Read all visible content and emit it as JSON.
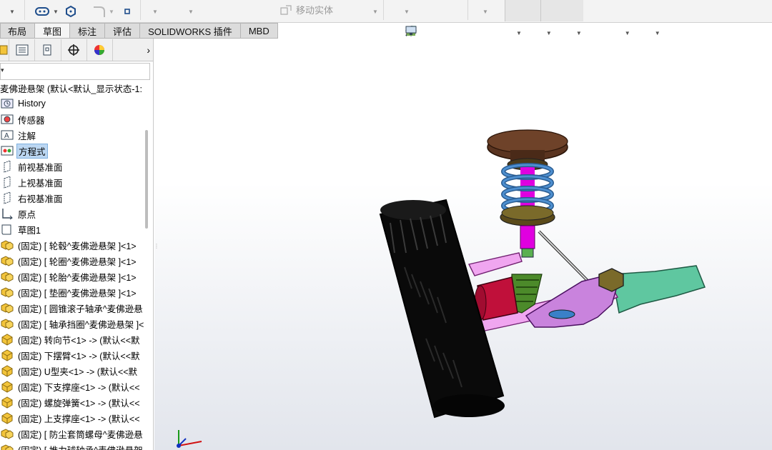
{
  "ribbon": {
    "move_body_label": "移动实体"
  },
  "tabs": [
    {
      "label": "布局",
      "active": false
    },
    {
      "label": "草图",
      "active": true
    },
    {
      "label": "标注",
      "active": false
    },
    {
      "label": "评估",
      "active": false
    },
    {
      "label": "SOLIDWORKS 插件",
      "active": false
    },
    {
      "label": "MBD",
      "active": false
    }
  ],
  "view_toolbar": {
    "icons": [
      "zoom-to-fit-icon",
      "zoom-to-area-icon",
      "previous-view-icon",
      "section-view-icon",
      "dynamic-annotation-icon",
      "view-orientation-icon",
      "display-style-icon",
      "hide-show-items-icon",
      "edit-appearance-icon",
      "apply-scene-icon",
      "view-settings-icon"
    ]
  },
  "feature_manager": {
    "root_label": "麦佛逊悬架 (默认<默认_显示状态-1:",
    "nodes": [
      {
        "label": "History",
        "icon": "history-icon",
        "selected": false
      },
      {
        "label": "传感器",
        "icon": "sensor-icon",
        "selected": false
      },
      {
        "label": "注解",
        "icon": "annotation-icon",
        "selected": false
      },
      {
        "label": "方程式",
        "icon": "equations-icon",
        "selected": true
      },
      {
        "label": "前视基准面",
        "icon": "plane-icon",
        "selected": false
      },
      {
        "label": "上视基准面",
        "icon": "plane-icon",
        "selected": false
      },
      {
        "label": "右视基准面",
        "icon": "plane-icon",
        "selected": false
      },
      {
        "label": "原点",
        "icon": "origin-icon",
        "selected": false
      },
      {
        "label": "草图1",
        "icon": "sketch-icon",
        "selected": false
      },
      {
        "label": "(固定) [ 轮毂^麦佛逊悬架 ]<1>",
        "icon": "subassembly-icon",
        "selected": false
      },
      {
        "label": "(固定) [ 轮圈^麦佛逊悬架 ]<1>",
        "icon": "subassembly-icon",
        "selected": false
      },
      {
        "label": "(固定) [ 轮胎^麦佛逊悬架 ]<1>",
        "icon": "subassembly-icon",
        "selected": false
      },
      {
        "label": "(固定) [ 垫圈^麦佛逊悬架 ]<1>",
        "icon": "subassembly-icon",
        "selected": false
      },
      {
        "label": "(固定) [ 圆锥滚子轴承^麦佛逊悬",
        "icon": "subassembly-icon",
        "selected": false
      },
      {
        "label": "(固定) [ 轴承挡圈^麦佛逊悬架 ]<",
        "icon": "subassembly-icon",
        "selected": false
      },
      {
        "label": "(固定) 转向节<1> -> (默认<<默",
        "icon": "part-icon",
        "selected": false
      },
      {
        "label": "(固定) 下摆臂<1> -> (默认<<默",
        "icon": "part-icon",
        "selected": false
      },
      {
        "label": "(固定) U型夹<1> -> (默认<<默",
        "icon": "part-icon",
        "selected": false
      },
      {
        "label": "(固定) 下支撑座<1> -> (默认<<",
        "icon": "part-icon",
        "selected": false
      },
      {
        "label": "(固定) 螺旋弹簧<1> -> (默认<<",
        "icon": "part-icon",
        "selected": false
      },
      {
        "label": "(固定) 上支撑座<1> -> (默认<<",
        "icon": "part-icon",
        "selected": false
      },
      {
        "label": "(固定) [ 防尘套筒螺母^麦佛逊悬",
        "icon": "subassembly-icon",
        "selected": false
      },
      {
        "label": "(固定) [ 推力球轴承^麦佛逊悬架",
        "icon": "subassembly-icon",
        "selected": false
      }
    ]
  },
  "colors": {
    "selection": "#bcd7f2",
    "tire": "#0a0a0a",
    "spring": "#3b7fc0",
    "strut": "#e000e0",
    "arm": "#cc88dd",
    "link": "#5fc7a0",
    "mount": "#5a3420"
  }
}
